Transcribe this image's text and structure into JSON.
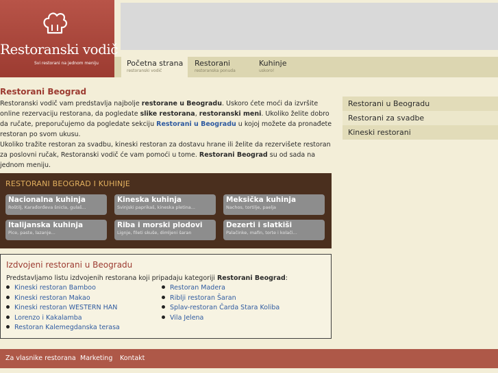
{
  "header": {
    "brand": "Restoranski vodič",
    "tagline": "Svi restorani na jednom meniju"
  },
  "nav": [
    {
      "title": "Početna strana",
      "sub": "restoranski vodič"
    },
    {
      "title": "Restorani",
      "sub": "restoranska ponuda"
    },
    {
      "title": "Kuhinje",
      "sub": "uskoro!"
    }
  ],
  "main": {
    "title": "Restorani Beograd",
    "intro": {
      "p1_a": "Restoranski vodič vam predstavlja najbolje ",
      "p1_b": "restorane u Beogradu",
      "p1_c": ". Uskoro ćete moći da izvršite online rezervaciju restorana, da pogledate ",
      "p1_d": "slike restorana",
      "p1_e": ", ",
      "p1_f": "restoranski meni",
      "p1_g": ". Ukoliko želite dobro da ručate, preporučujemo da pogledate sekciju ",
      "p1_link": "Restorani u Beogradu",
      "p1_h": " u kojoj možete da pronađete restoran po svom ukusu.",
      "p2_a": "Ukoliko tražite restoran za svadbu, kineski restoran za dostavu hrane ili želite da rezervišete restoran za poslovni ručak, Restoranski vodič će vam pomoći u tome. ",
      "p2_b": "Restorani Beograd",
      "p2_c": " su od sada na jednom meniju."
    }
  },
  "sidebar": [
    "Restorani u Beogradu",
    "Restorani za svadbe",
    "Kineski restorani"
  ],
  "kitchens": {
    "title": "RESTORANI BEOGRAD I KUHINJE",
    "items": [
      {
        "name": "Nacionalna kuhinja",
        "desc": "Roštilj, Karađorđeva šnicla, gulaš..."
      },
      {
        "name": "Kineska kuhinja",
        "desc": "Svinjski paprikaš, kineska pletina..."
      },
      {
        "name": "Meksička kuhinja",
        "desc": "Nachos, tortilje, paelja"
      },
      {
        "name": "Italijanska kuhinja",
        "desc": "Pice, paste, lazanje..."
      },
      {
        "name": "Riba i morski plodovi",
        "desc": "Lignje, fileti skuše, dimljeni šaran"
      },
      {
        "name": "Dezerti i slatkiši",
        "desc": "Palačinke, mafin, torte i kolači..."
      }
    ]
  },
  "featured": {
    "title": "Izdvojeni restorani u Beogradu",
    "intro_a": "Predstavljamo listu izdvojenih restorana koji pripadaju kategoriji ",
    "intro_b": "Restorani Beograd",
    "intro_c": ":",
    "left": [
      "Kineski restoran Bamboo",
      "Kineski restoran Makao",
      "Kineski restoran WESTERN HAN",
      "Lorenzo i Kakalamba",
      "Restoran Kalemegdanska terasa"
    ],
    "right": [
      "Restoran Madera",
      "Riblji restoran Šaran",
      "Splav-restoran Čarda Stara Koliba",
      "Vila Jelena"
    ]
  },
  "footer": [
    "Za vlasnike restorana",
    "Marketing",
    "Kontakt"
  ]
}
